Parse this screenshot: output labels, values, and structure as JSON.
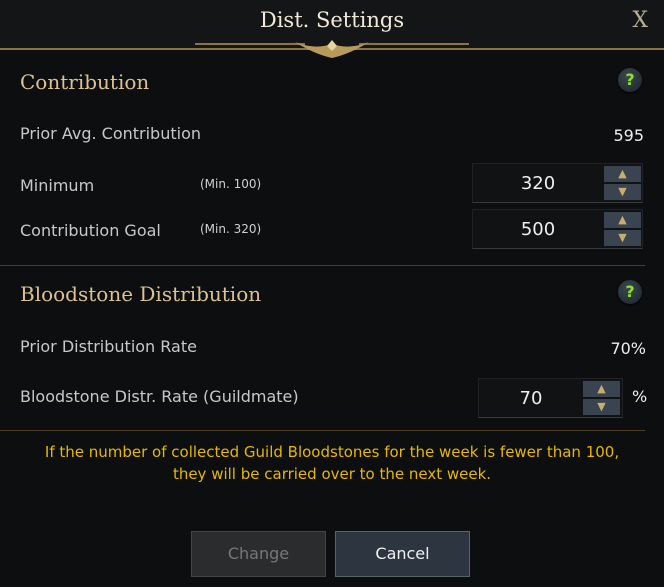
{
  "title": "Dist. Settings",
  "close_label": "X",
  "contribution": {
    "heading": "Contribution",
    "help": "?",
    "prior_label": "Prior Avg. Contribution",
    "prior_value": "595",
    "minimum_label": "Minimum",
    "minimum_hint": "(Min. 100)",
    "minimum_value": "320",
    "goal_label": "Contribution Goal",
    "goal_hint": "(Min. 320)",
    "goal_value": "500"
  },
  "bloodstone": {
    "heading": "Bloodstone Distribution",
    "help": "?",
    "prior_label": "Prior Distribution Rate",
    "prior_value": "70%",
    "rate_label": "Bloodstone Distr. Rate (Guildmate)",
    "rate_value": "70",
    "rate_unit": "%"
  },
  "note": "If the number of collected Guild Bloodstones for the week is fewer than 100,\nthey will be carried over to the next week.",
  "buttons": {
    "change": "Change",
    "cancel": "Cancel"
  },
  "icons": {
    "up": "▲",
    "down": "▼"
  }
}
